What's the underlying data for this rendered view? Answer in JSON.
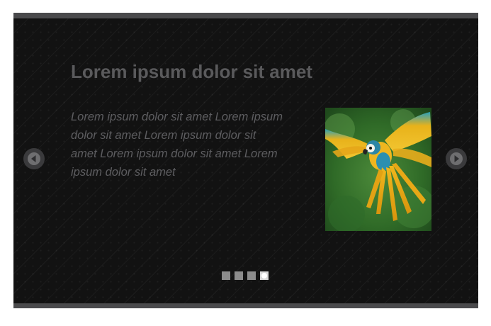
{
  "slider": {
    "title": "Lorem ipsum dolor sit amet",
    "text": "Lorem ipsum dolor sit amet Lorem ipsum dolor sit amet Lorem ipsum dolor sit amet Lorem ipsum dolor sit amet Lorem ipsum dolor sit amet",
    "image": {
      "icon": "parrot-photo"
    },
    "prev_icon": "chevron-left-icon",
    "next_icon": "chevron-right-icon",
    "pager": {
      "count": 4,
      "active_index": 3
    }
  },
  "colors": {
    "background": "#121212",
    "bar": "#4a4a4c",
    "title": "#5a5a5c",
    "text": "#5d5d60"
  }
}
